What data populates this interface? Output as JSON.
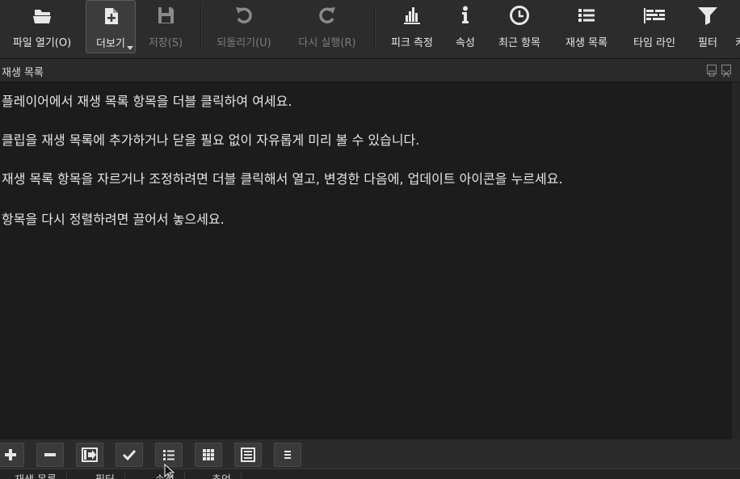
{
  "toolbar": {
    "open_file": "파일 열기(O)",
    "more": "더보기",
    "save": "저장(S)",
    "undo": "되돌리기(U)",
    "redo": "다시 실행(R)",
    "peak_meter": "피크 측정",
    "properties": "속성",
    "recent": "최근 항목",
    "playlist": "재생 목록",
    "timeline": "타임 라인",
    "filters": "필터",
    "overflow": "키"
  },
  "panel": {
    "title": "재생 목록"
  },
  "content": {
    "paragraphs": [
      "플레이어에서 재생 목록 항목을 더블 클릭하여 여세요.",
      "클립을 재생 목록에 추가하거나 닫을 필요 없이 자유롭게 미리 볼 수 있습니다.",
      "재생 목록 항목을 자르거나 조정하려면 더블 클릭해서 열고, 변경한 다음에, 업데이트 아이콘을 누르세요.",
      "항목을 다시 정렬하려면 끌어서 놓으세요."
    ]
  },
  "bottom_buttons": [
    "add-icon",
    "remove-icon",
    "update-icon",
    "check-icon",
    "list-view-icon",
    "grid-view-icon",
    "details-view-icon",
    "menu-icon"
  ],
  "tabs": [
    "재생 목록",
    "필터",
    "속성",
    "추억"
  ],
  "colors": {
    "background": "#1f1f1f",
    "toolbar": "#2c2c2c",
    "text": "#e6e6e6",
    "disabled_text": "#7d7d7d"
  }
}
